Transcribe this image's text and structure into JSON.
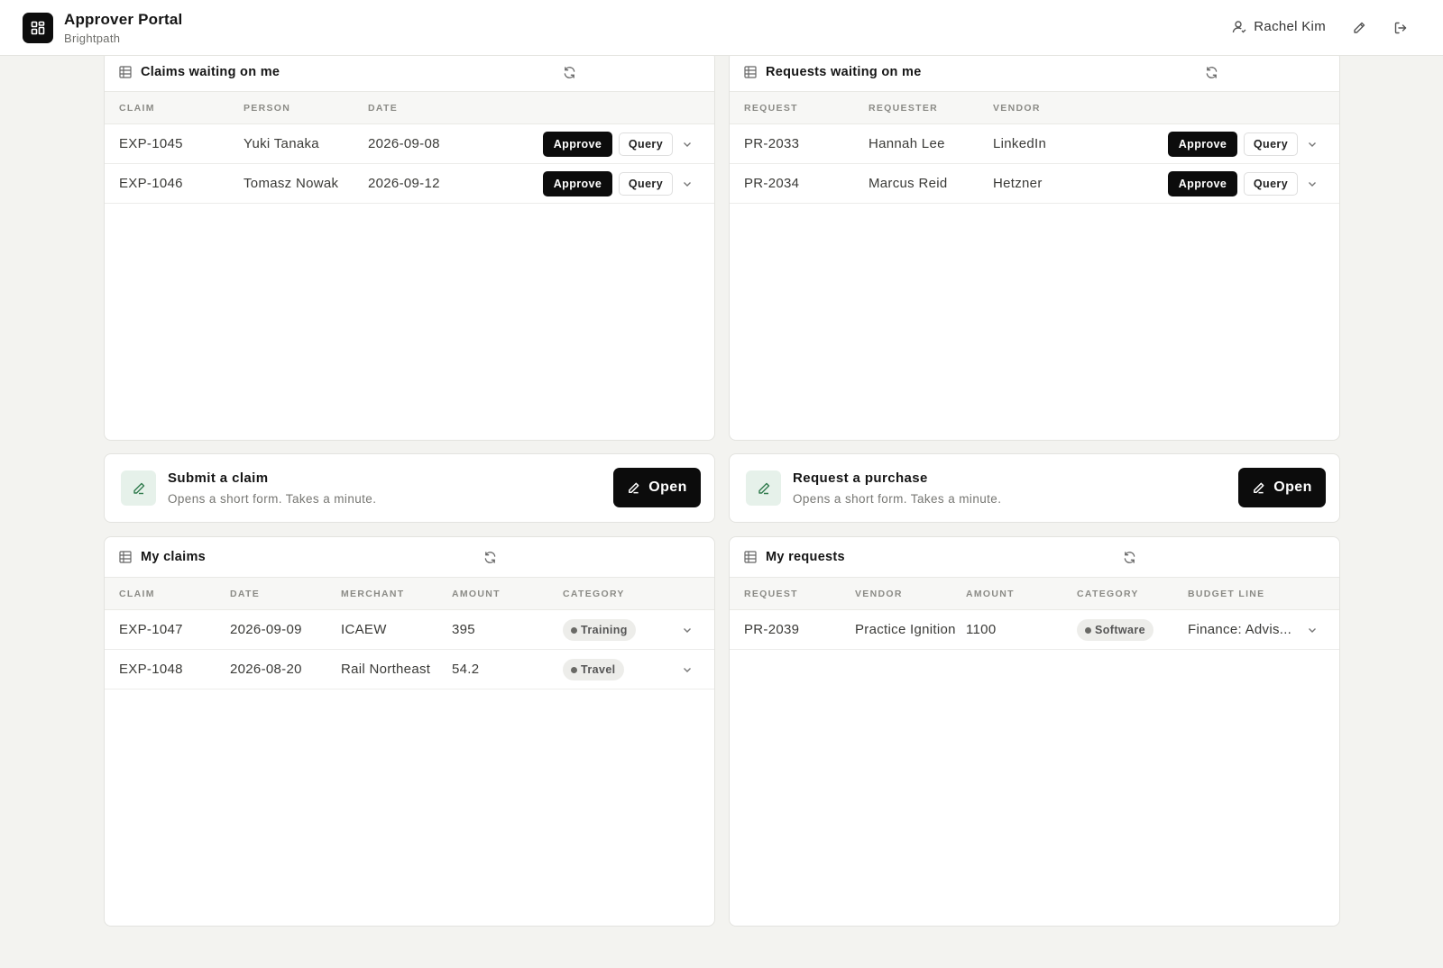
{
  "header": {
    "app_title": "Approver Portal",
    "app_subtitle": "Brightpath",
    "user_name": "Rachel Kim"
  },
  "claims_waiting": {
    "title": "Claims waiting on me",
    "columns": [
      "CLAIM",
      "PERSON",
      "DATE"
    ],
    "rows": [
      {
        "claim": "EXP-1045",
        "person": "Yuki Tanaka",
        "date": "2026-09-08"
      },
      {
        "claim": "EXP-1046",
        "person": "Tomasz Nowak",
        "date": "2026-09-12"
      }
    ],
    "approve_label": "Approve",
    "query_label": "Query"
  },
  "requests_waiting": {
    "title": "Requests waiting on me",
    "columns": [
      "REQUEST",
      "REQUESTER",
      "VENDOR"
    ],
    "rows": [
      {
        "request": "PR-2033",
        "requester": "Hannah Lee",
        "vendor": "LinkedIn"
      },
      {
        "request": "PR-2034",
        "requester": "Marcus Reid",
        "vendor": "Hetzner"
      }
    ],
    "approve_label": "Approve",
    "query_label": "Query"
  },
  "submit_claim": {
    "title": "Submit a claim",
    "subtitle": "Opens a short form. Takes a minute.",
    "button_label": "Open"
  },
  "request_purchase": {
    "title": "Request a purchase",
    "subtitle": "Opens a short form. Takes a minute.",
    "button_label": "Open"
  },
  "my_claims": {
    "title": "My claims",
    "columns": [
      "CLAIM",
      "DATE",
      "MERCHANT",
      "AMOUNT",
      "CATEGORY"
    ],
    "rows": [
      {
        "claim": "EXP-1047",
        "date": "2026-09-09",
        "merchant": "ICAEW",
        "amount": "395",
        "category": "Training"
      },
      {
        "claim": "EXP-1048",
        "date": "2026-08-20",
        "merchant": "Rail Northeast",
        "amount": "54.2",
        "category": "Travel"
      }
    ]
  },
  "my_requests": {
    "title": "My requests",
    "columns": [
      "REQUEST",
      "VENDOR",
      "AMOUNT",
      "CATEGORY",
      "BUDGET LINE"
    ],
    "rows": [
      {
        "request": "PR-2039",
        "vendor": "Practice Ignition",
        "amount": "1100",
        "category": "Software",
        "budget_line": "Finance: Advis..."
      }
    ]
  },
  "icons": {
    "logo": "dashboard-grid-icon",
    "user": "user-icon",
    "edit": "pencil-icon",
    "logout": "logout-icon",
    "table": "table-icon",
    "refresh": "refresh-icon",
    "chevron": "chevron-down-icon"
  },
  "colors": {
    "primary": "#0c0c0c",
    "background": "#f3f3f0",
    "action_icon_bg": "#e6f1ea",
    "action_icon_fg": "#2f7a4c",
    "badge_bg": "#ededea"
  }
}
